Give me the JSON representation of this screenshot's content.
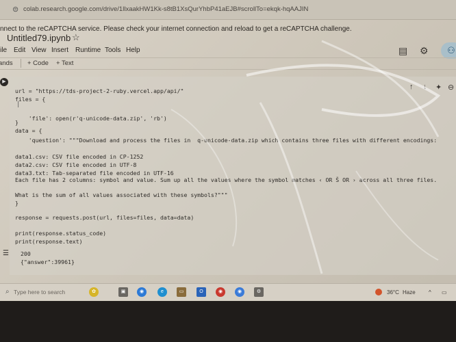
{
  "browser": {
    "url": "colab.research.google.com/drive/1llxaakHW1Kk-s8tB1XsQurYhbP41aEJB#scrollTo=ekqk-hqAAJIN"
  },
  "banner": {
    "text": "nnect to the reCAPTCHA service. Please check your internet connection and reload to get a reCAPTCHA challenge."
  },
  "notebook": {
    "title": "Untitled79.ipynb"
  },
  "menu": [
    "File",
    "Edit",
    "View",
    "Insert",
    "Runtime",
    "Tools",
    "Help"
  ],
  "toolbar": {
    "commands": "ands",
    "code": "+ Code",
    "text": "+ Text"
  },
  "cell": {
    "code_lines": [
      "url = \"https://tds-project-2-ruby.vercel.app/api/\"",
      "files = {",
      "",
      "    'file': open(r'q-unicode-data.zip', 'rb')",
      "}",
      "data = {",
      "    'question': \"\"\"Download and process the files in  q-unicode-data.zip which contains three files with different encodings:",
      "",
      "data1.csv: CSV file encoded in CP-1252",
      "data2.csv: CSV file encoded in UTF-8",
      "data3.txt: Tab-separated file encoded in UTF-16",
      "Each file has 2 columns: symbol and value. Sum up all the values where the symbol matches ‹ OR Š OR › across all three files.",
      "",
      "What is the sum of all values associated with these symbols?\"\"\"",
      "}",
      "",
      "response = requests.post(url, files=files, data=data)",
      "",
      "print(response.status_code)",
      "print(response.text)"
    ],
    "output_lines": [
      "200",
      "{\"answer\":39961}"
    ]
  },
  "taskbar": {
    "search_placeholder": "Type here to search",
    "temperature": "36°C",
    "weather": "Haze"
  }
}
